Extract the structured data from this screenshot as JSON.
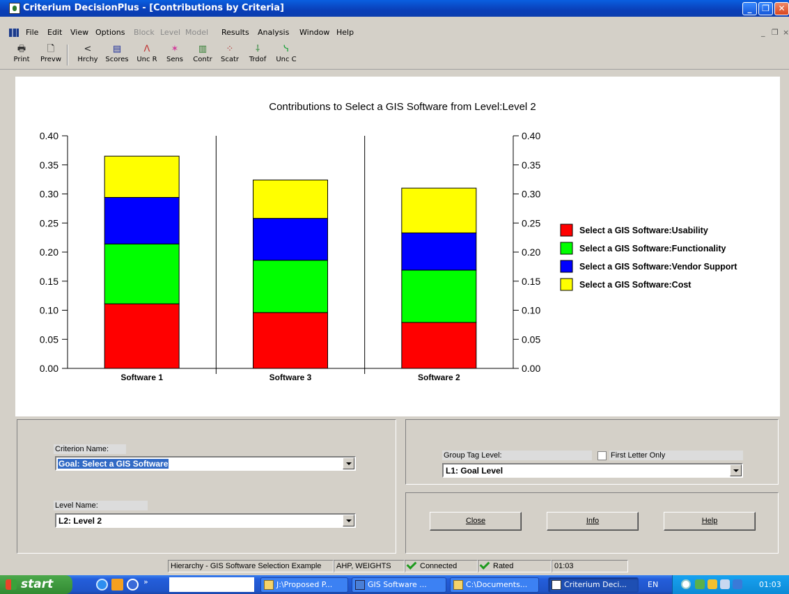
{
  "window": {
    "title": "Criterium DecisionPlus - [Contributions by Criteria]"
  },
  "menu": {
    "items": [
      {
        "label": "File",
        "enabled": true
      },
      {
        "label": "Edit",
        "enabled": true
      },
      {
        "label": "View",
        "enabled": true
      },
      {
        "label": "Options",
        "enabled": true
      },
      {
        "label": "Block",
        "enabled": false
      },
      {
        "label": "Level",
        "enabled": false
      },
      {
        "label": "Model",
        "enabled": false
      },
      {
        "label": "Results",
        "enabled": true
      },
      {
        "label": "Analysis",
        "enabled": true
      },
      {
        "label": "Window",
        "enabled": true
      },
      {
        "label": "Help",
        "enabled": true
      }
    ]
  },
  "toolbar": {
    "tools": [
      {
        "label": "Print",
        "icon": "printer-icon"
      },
      {
        "label": "Prevw",
        "icon": "preview-icon"
      },
      {
        "label": "Hrchy",
        "icon": "hierarchy-icon"
      },
      {
        "label": "Scores",
        "icon": "scores-icon"
      },
      {
        "label": "Unc R",
        "icon": "uncertainty-r-icon"
      },
      {
        "label": "Sens",
        "icon": "sensitivity-icon"
      },
      {
        "label": "Contr",
        "icon": "contributions-icon"
      },
      {
        "label": "Scatr",
        "icon": "scatter-icon"
      },
      {
        "label": "Trdof",
        "icon": "tradeoff-icon"
      },
      {
        "label": "Unc C",
        "icon": "uncertainty-c-icon"
      }
    ]
  },
  "chart_data": {
    "type": "bar",
    "stacked": true,
    "title": "Contributions to Select a GIS Software from Level:Level 2",
    "categories": [
      "Software 1",
      "Software 3",
      "Software 2"
    ],
    "series": [
      {
        "name": "Select a GIS Software:Usability",
        "color": "#ff0000",
        "values": [
          0.111,
          0.096,
          0.079
        ]
      },
      {
        "name": "Select a GIS Software:Functionality",
        "color": "#00ff00",
        "values": [
          0.103,
          0.09,
          0.09
        ]
      },
      {
        "name": "Select a GIS Software:Vendor Support",
        "color": "#0000ff",
        "values": [
          0.08,
          0.072,
          0.064
        ]
      },
      {
        "name": "Select a GIS Software:Cost",
        "color": "#ffff00",
        "values": [
          0.071,
          0.066,
          0.077
        ]
      }
    ],
    "ylim": [
      0,
      0.4
    ],
    "yticks": [
      "0.00",
      "0.05",
      "0.10",
      "0.15",
      "0.20",
      "0.25",
      "0.30",
      "0.35",
      "0.40"
    ],
    "legend_position": "right",
    "grid": false
  },
  "criterion": {
    "label": "Criterion Name:",
    "value": "Goal: Select a GIS Software"
  },
  "level": {
    "label": "Level Name:",
    "value": "L2: Level 2"
  },
  "group_tag": {
    "label": "Group Tag Level:",
    "value": "L1: Goal Level",
    "first_letter_only": "First Letter Only"
  },
  "buttons": {
    "close": "Close",
    "info": "Info",
    "help": "Help"
  },
  "status": {
    "hierarchy": "Hierarchy - GIS Software Selection Example",
    "mode": "AHP, WEIGHTS",
    "connected": "Connected",
    "rated": "Rated",
    "time": "01:03"
  },
  "taskbar": {
    "start": "start",
    "tasks": [
      {
        "label": "J:\\Proposed P...",
        "active": false
      },
      {
        "label": "GIS Software ...",
        "active": false
      },
      {
        "label": "C:\\Documents...",
        "active": false
      },
      {
        "label": "Criterium Deci...",
        "active": true
      }
    ],
    "language": "EN",
    "clock": "01:03"
  }
}
